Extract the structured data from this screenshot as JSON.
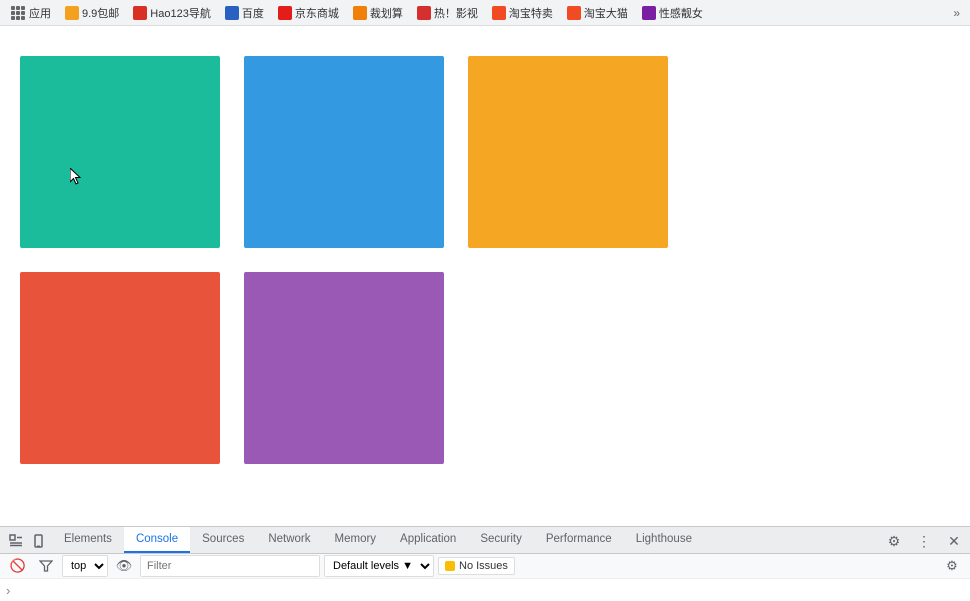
{
  "bookmark_bar": {
    "items": [
      {
        "label": "应用",
        "icon_color": "#4285f4",
        "type": "apps"
      },
      {
        "label": "9.9包邮",
        "icon_color": "#f4a020"
      },
      {
        "label": "Hao123导航",
        "icon_color": "#d93025"
      },
      {
        "label": "百度",
        "icon_color": "#2861c2"
      },
      {
        "label": "京东商城",
        "icon_color": "#e31d1a"
      },
      {
        "label": "裁划算",
        "icon_color": "#f08009"
      },
      {
        "label": "热！影视",
        "icon_color": "#d62f2f"
      },
      {
        "label": "淘宝特卖",
        "icon_color": "#f04b23"
      },
      {
        "label": "淘宝大猫",
        "icon_color": "#f04b23"
      },
      {
        "label": "性感靓女",
        "icon_color": "#7b1fa2"
      }
    ]
  },
  "color_boxes": {
    "row1": [
      {
        "color": "#1abc9c",
        "name": "teal-box"
      },
      {
        "color": "#3399e0",
        "name": "blue-box"
      },
      {
        "color": "#f5a623",
        "name": "yellow-box"
      }
    ],
    "row2": [
      {
        "color": "#e8533b",
        "name": "red-box"
      },
      {
        "color": "#9b59b6",
        "name": "purple-box"
      }
    ]
  },
  "devtools": {
    "tabs": [
      {
        "label": "Elements",
        "active": false
      },
      {
        "label": "Console",
        "active": true
      },
      {
        "label": "Sources",
        "active": false
      },
      {
        "label": "Network",
        "active": false
      },
      {
        "label": "Memory",
        "active": false
      },
      {
        "label": "Application",
        "active": false
      },
      {
        "label": "Security",
        "active": false
      },
      {
        "label": "Performance",
        "active": false
      },
      {
        "label": "Lighthouse",
        "active": false
      }
    ],
    "toolbar": {
      "context_value": "top",
      "filter_placeholder": "Filter",
      "levels_label": "Default levels",
      "no_issues_label": "No Issues"
    }
  }
}
